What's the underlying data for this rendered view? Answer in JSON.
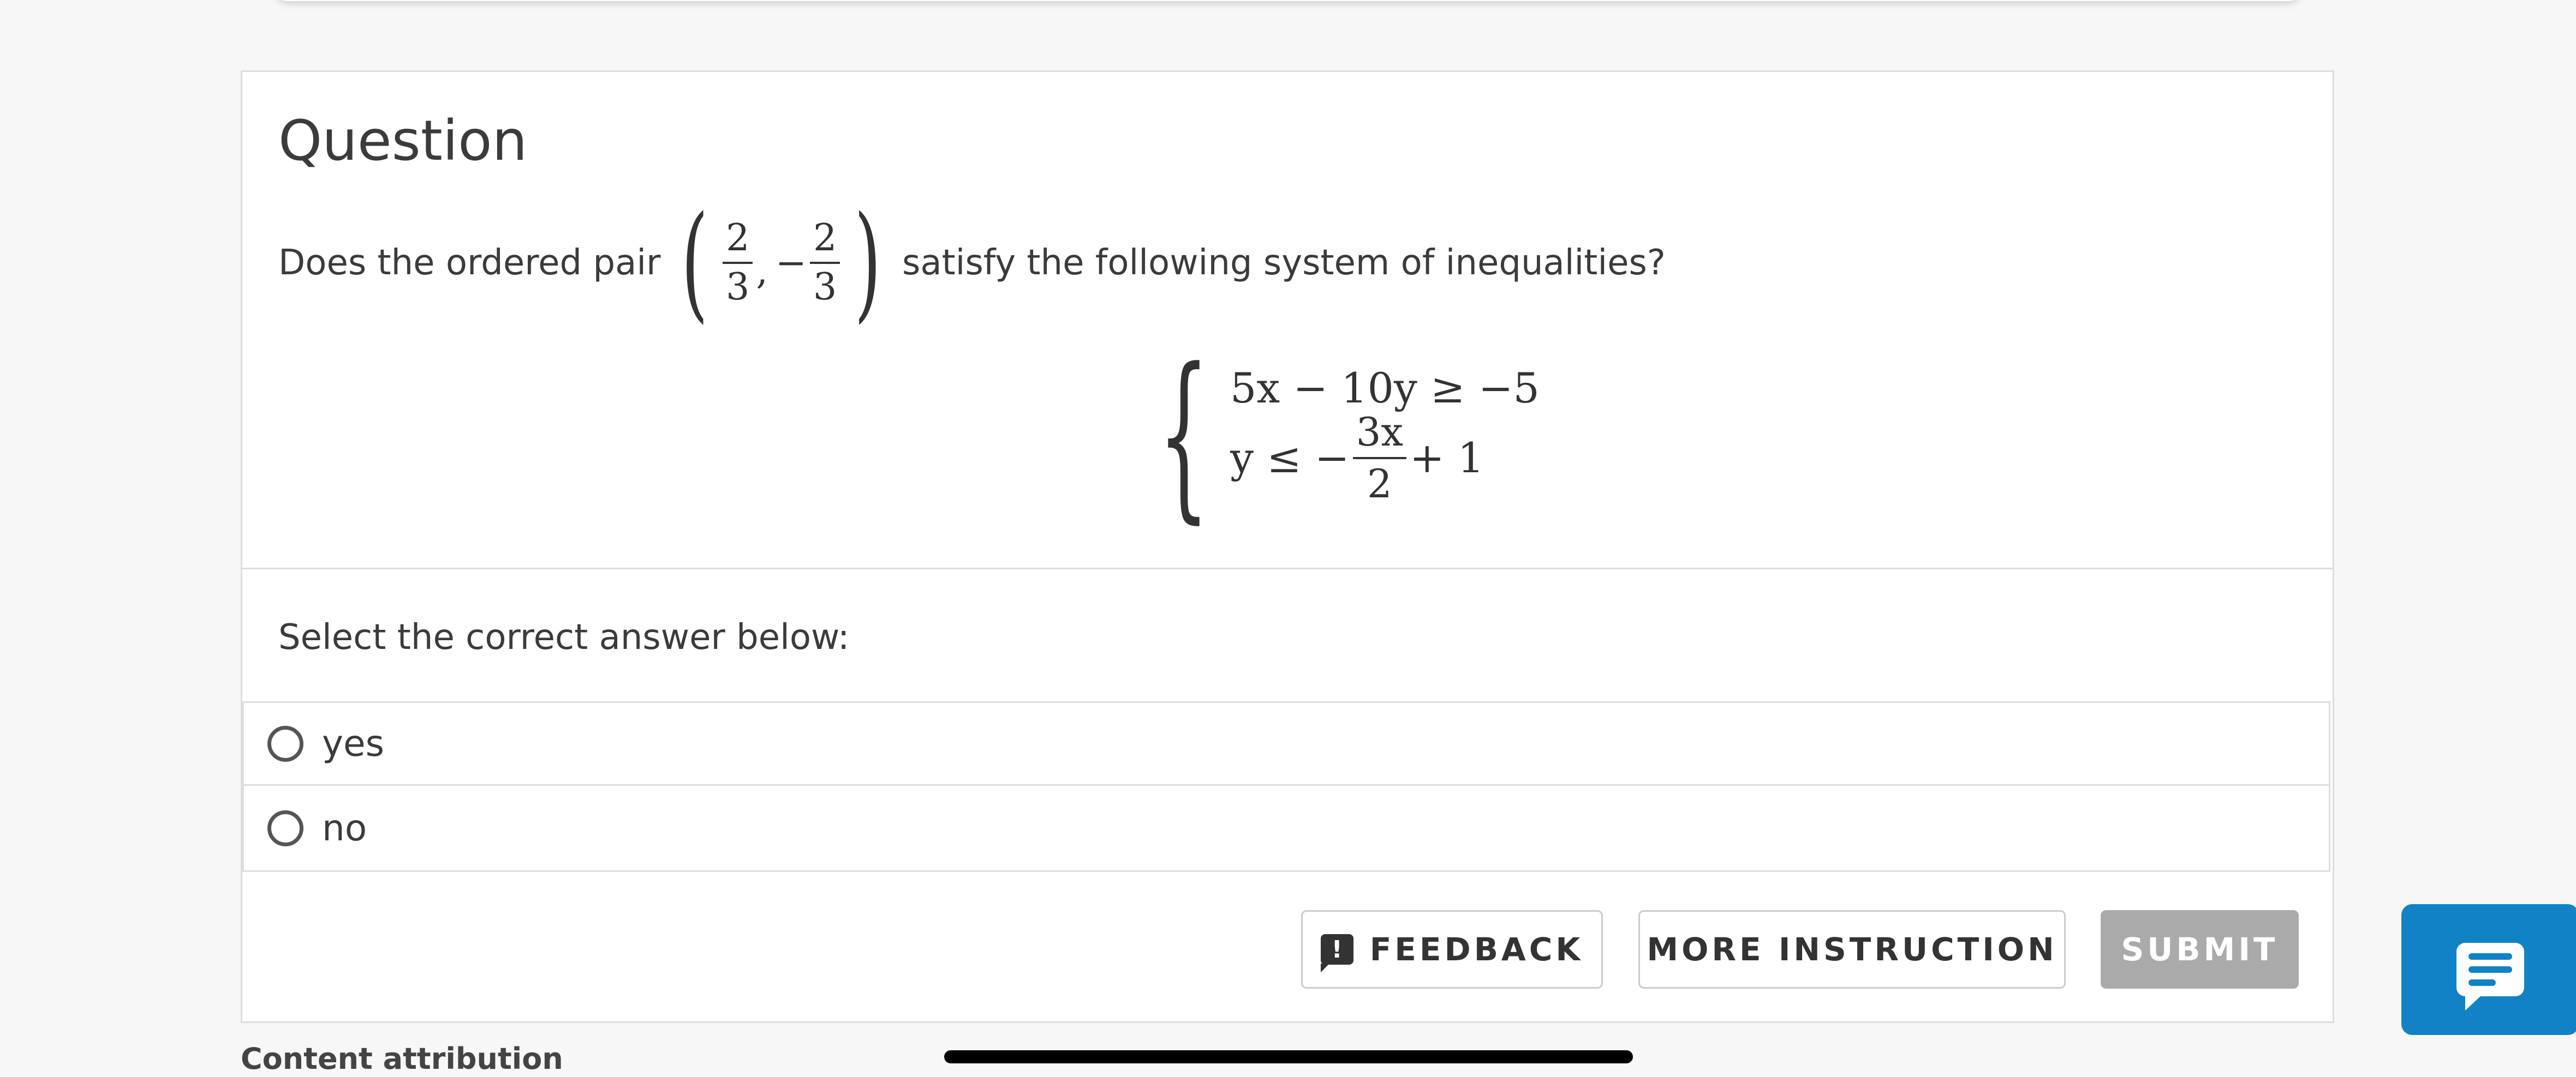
{
  "question": {
    "title": "Question",
    "prompt_before": "Does the ordered pair",
    "pair": {
      "first": {
        "num": "2",
        "den": "3"
      },
      "comma": ",",
      "second_sign": "−",
      "second": {
        "num": "2",
        "den": "3"
      }
    },
    "prompt_after": "satisfy the following system of inequalities?",
    "system": {
      "line1": "5x − 10y ≥ −5",
      "line2_left": "y ≤ −",
      "line2_frac": {
        "num": "3x",
        "den": "2"
      },
      "line2_right": "+ 1"
    }
  },
  "answers": {
    "label": "Select the correct answer below:",
    "options": [
      "yes",
      "no"
    ]
  },
  "buttons": {
    "feedback": "FEEDBACK",
    "feedback_icon": "!",
    "more_instruction": "MORE INSTRUCTION",
    "submit": "SUBMIT"
  },
  "footer": {
    "attribution": "Content attribution"
  },
  "icons": {
    "feedback": "feedback-icon",
    "chat": "chat-icon",
    "radio": "radio-icon"
  },
  "colors": {
    "accent": "#1183c4",
    "submit_disabled": "#aaaaaa"
  }
}
